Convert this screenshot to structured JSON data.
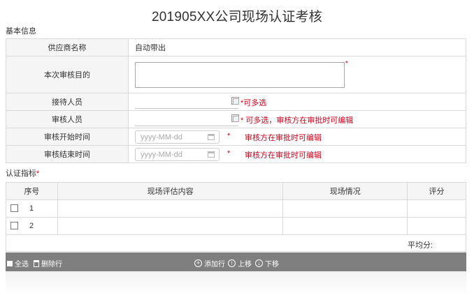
{
  "page": {
    "title": "201905XX公司现场认证考核"
  },
  "basic_info": {
    "section_title": "基本信息",
    "fields": {
      "supplier_label": "供应商名称",
      "supplier_value": "自动带出",
      "purpose_label": "本次审核目的",
      "receiver_label": "接待人员",
      "receiver_note": "*可多选",
      "auditor_label": "审核人员",
      "auditor_note": "* 可多选，审核方在审批时可编辑",
      "start_label": "审核开始时间",
      "start_placeholder": "yyyy-MM-dd",
      "end_label": "审核结束时间",
      "end_placeholder": "yyyy-MM-dd",
      "date_star": "*",
      "date_note": "审核方在审批时可编辑",
      "required_star": "*"
    }
  },
  "indicators": {
    "section_title": "认证指标",
    "required_star": "*",
    "columns": [
      "序号",
      "现场评估内容",
      "现场情况",
      "评分"
    ],
    "rows": [
      {
        "seq": "1"
      },
      {
        "seq": "2"
      }
    ],
    "average_label": "平均分:"
  },
  "toolbar": {
    "select_all": "全选",
    "delete_row": "删除行",
    "add_row": "添加行",
    "move_up": "上移",
    "move_down": "下移"
  },
  "colors": {
    "required": "#d0021b",
    "toolbar_bg": "#7f7f7f",
    "label_bg": "#f5f5f5"
  }
}
